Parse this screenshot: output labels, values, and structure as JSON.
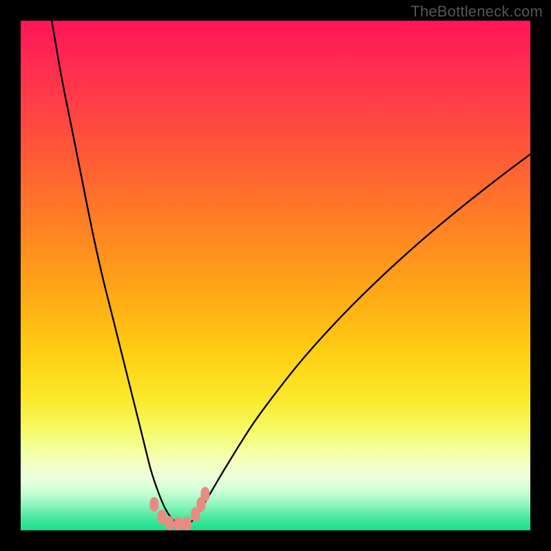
{
  "watermark": "TheBottleneck.com",
  "colors": {
    "background": "#000000",
    "curve_stroke": "#000000",
    "marker_fill": "#e98a83",
    "gradient_top": "#ff1558",
    "gradient_mid": "#ffd114",
    "gradient_bottom": "#18df8c"
  },
  "chart_data": {
    "type": "line",
    "title": "",
    "xlabel": "",
    "ylabel": "",
    "xlim": [
      0,
      100
    ],
    "ylim": [
      0,
      100
    ],
    "grid": false,
    "annotations": [],
    "series": [
      {
        "name": "bottleneck-curve",
        "x": [
          6.1,
          8,
          10,
          12,
          14,
          16,
          18,
          20,
          22,
          24,
          25.5,
          27,
          28.4,
          29.7,
          31,
          32,
          33,
          34,
          36,
          40,
          46,
          54,
          62,
          70,
          78,
          86,
          94,
          100
        ],
        "y": [
          100,
          89,
          79,
          69,
          59,
          50,
          42,
          34,
          26,
          18,
          12,
          7.5,
          4.2,
          2.3,
          1.4,
          1.2,
          1.5,
          2.2,
          5.2,
          12,
          21.5,
          32,
          41,
          49,
          56.3,
          63,
          69.3,
          73.8
        ]
      }
    ],
    "markers": [
      {
        "x": 26.2,
        "y": 5.1
      },
      {
        "x": 27.7,
        "y": 2.6
      },
      {
        "x": 29.2,
        "y": 1.4
      },
      {
        "x": 31.0,
        "y": 1.2
      },
      {
        "x": 32.6,
        "y": 1.3
      },
      {
        "x": 34.3,
        "y": 3.1
      },
      {
        "x": 35.4,
        "y": 5.1
      },
      {
        "x": 36.2,
        "y": 7.1
      }
    ],
    "minimum": {
      "x": 31,
      "y": 1.2
    }
  }
}
